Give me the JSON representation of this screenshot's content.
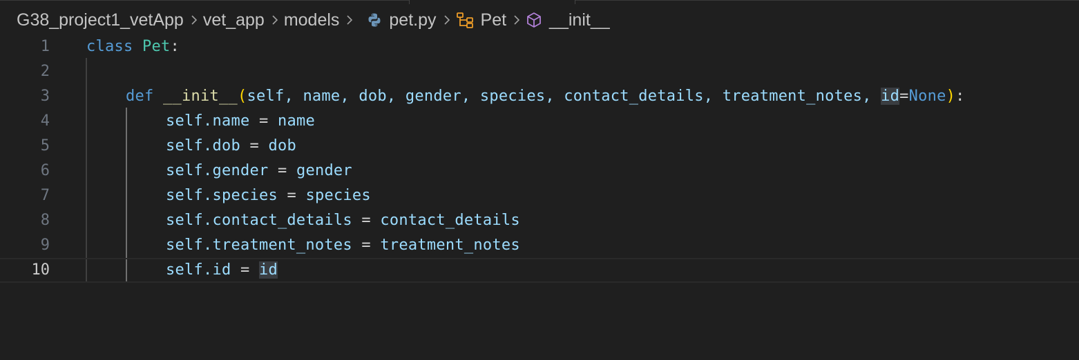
{
  "breadcrumb": {
    "items": [
      {
        "label": "G38_project1_vetApp"
      },
      {
        "label": "vet_app"
      },
      {
        "label": "models"
      },
      {
        "label": "pet.py",
        "icon": "python-icon"
      },
      {
        "label": "Pet",
        "icon": "class-symbol-icon"
      },
      {
        "label": "__init__",
        "icon": "method-symbol-icon"
      }
    ]
  },
  "editor": {
    "line_numbers": [
      "1",
      "2",
      "3",
      "4",
      "5",
      "6",
      "7",
      "8",
      "9",
      "10"
    ],
    "current_line": "10",
    "lines": {
      "l1": {
        "kw": "class",
        "name": "Pet",
        "colon": ":"
      },
      "l3": {
        "def": "def",
        "fn": "__init__",
        "open": "(",
        "params": "self, name, dob, gender, species, contact_details, treatment_notes, ",
        "id": "id",
        "eq": "=",
        "none": "None",
        "close": ")",
        "colon": ":"
      },
      "l4": {
        "lhs": "self.name",
        "eq": " = ",
        "rhs": "name"
      },
      "l5": {
        "lhs": "self.dob",
        "eq": " = ",
        "rhs": "dob"
      },
      "l6": {
        "lhs": "self.gender",
        "eq": " = ",
        "rhs": "gender"
      },
      "l7": {
        "lhs": "self.species",
        "eq": " = ",
        "rhs": "species"
      },
      "l8": {
        "lhs": "self.contact_details",
        "eq": " = ",
        "rhs": "contact_details"
      },
      "l9": {
        "lhs": "self.treatment_notes",
        "eq": " = ",
        "rhs": "treatment_notes"
      },
      "l10": {
        "lhs": "self.id",
        "eq": " = ",
        "rhs": "id"
      }
    }
  },
  "colors": {
    "background": "#1f1f1f",
    "keyword": "#569cd6",
    "class_name": "#4ec9b0",
    "function": "#dcdcaa",
    "variable": "#9cdcfe",
    "bracket": "#ffd700",
    "highlight": "#3a3d41"
  }
}
